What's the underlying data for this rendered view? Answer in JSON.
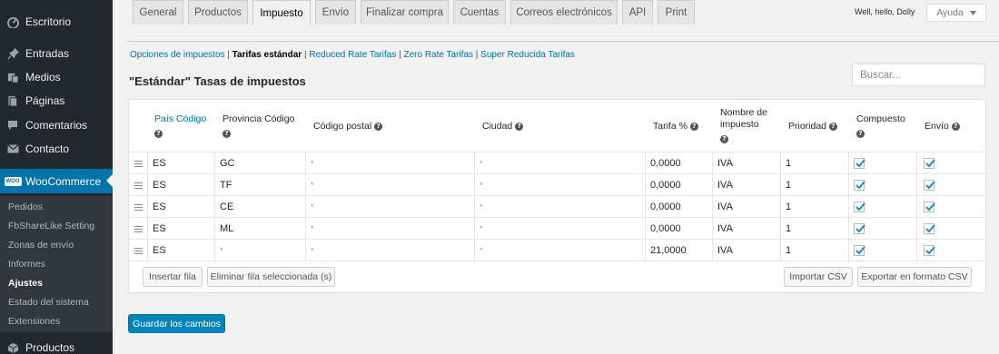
{
  "sidebar": {
    "items": [
      {
        "label": "Escritorio",
        "icon": "dashboard-icon"
      },
      {
        "label": "Entradas",
        "icon": "pin-icon"
      },
      {
        "label": "Medios",
        "icon": "media-icon"
      },
      {
        "label": "Páginas",
        "icon": "pages-icon"
      },
      {
        "label": "Comentarios",
        "icon": "comments-icon"
      },
      {
        "label": "Contacto",
        "icon": "mail-icon"
      },
      {
        "label": "WooCommerce",
        "icon": "woocommerce-icon",
        "badge": "WOO"
      },
      {
        "label": "Productos",
        "icon": "products-icon"
      }
    ],
    "submenu": [
      "Pedidos",
      "FbShareLike Setting",
      "Zonas de envío",
      "Informes",
      "Ajustes",
      "Estado del sistema",
      "Extensiones"
    ]
  },
  "header": {
    "howdy": "Well, hello, Dolly",
    "help_label": "Ayuda"
  },
  "tabs": [
    "General",
    "Productos",
    "Impuesto",
    "Envío",
    "Finalizar compra",
    "Cuentas",
    "Correos electrónicos",
    "API",
    "Print"
  ],
  "subsections": {
    "items": [
      "Opciones de impuestos",
      "Tarifas estándar",
      "Reduced Rate Tarifas",
      "Zero Rate Tarifas",
      "Super Reducida Tarifas"
    ],
    "separator": " | "
  },
  "page_title": "\"Estándar\" Tasas de impuestos",
  "search": {
    "placeholder": "Buscar..."
  },
  "table": {
    "headers": {
      "country": "País Código",
      "state": "Provincia Código",
      "postcode": "Código postal",
      "city": "Ciudad",
      "rate": "Tarifa %",
      "name_line1": "Nombre de",
      "name_line2": "impuesto",
      "priority": "Prioridad",
      "compound": "Compuesto",
      "shipping": "Envío"
    },
    "rows": [
      {
        "country": "ES",
        "state": "GC",
        "postcode": "*",
        "city": "*",
        "rate": "0,0000",
        "name": "IVA",
        "priority": "1",
        "compound": true,
        "shipping": true
      },
      {
        "country": "ES",
        "state": "TF",
        "postcode": "*",
        "city": "*",
        "rate": "0,0000",
        "name": "IVA",
        "priority": "1",
        "compound": true,
        "shipping": true
      },
      {
        "country": "ES",
        "state": "CE",
        "postcode": "*",
        "city": "*",
        "rate": "0,0000",
        "name": "IVA",
        "priority": "1",
        "compound": true,
        "shipping": true
      },
      {
        "country": "ES",
        "state": "ML",
        "postcode": "*",
        "city": "*",
        "rate": "0,0000",
        "name": "IVA",
        "priority": "1",
        "compound": true,
        "shipping": true
      },
      {
        "country": "ES",
        "state": "*",
        "postcode": "*",
        "city": "*",
        "rate": "21,0000",
        "name": "IVA",
        "priority": "1",
        "compound": true,
        "shipping": true
      }
    ],
    "buttons": {
      "insert": "Insertar fila",
      "remove": "Eliminar fila seleccionada (s)",
      "import": "Importar CSV",
      "export": "Exportar en formato CSV"
    }
  },
  "save_button": "Guardar los cambios",
  "colors": {
    "accent": "#0073aa",
    "sidebar_bg": "#23282d",
    "save": "#0085ba"
  }
}
